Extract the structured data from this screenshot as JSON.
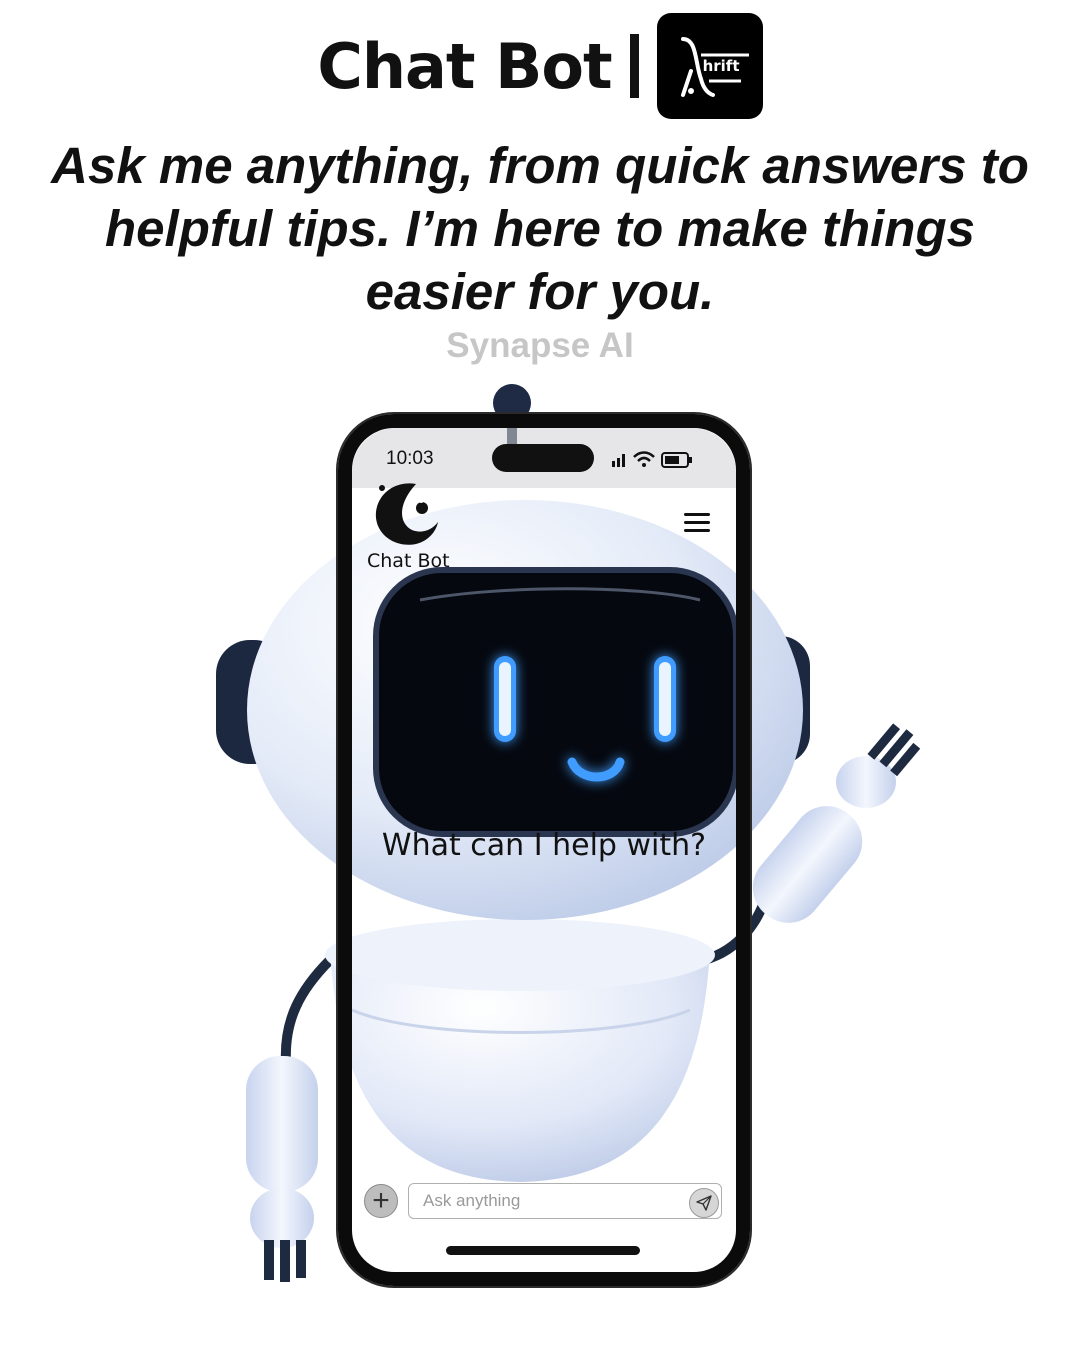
{
  "header": {
    "brand_title": "Chat Bot",
    "logo_text": "hrift"
  },
  "tagline": "Ask me anything, from quick answers to helpful tips. I’m here to make things easier for you.",
  "subtitle": "Synapse AI",
  "phone": {
    "status_bar": {
      "time": "10:03",
      "icons": [
        "signal-icon",
        "wifi-icon",
        "battery-icon"
      ]
    },
    "app": {
      "name": "Chat Bot",
      "menu_icon": "hamburger-menu-icon",
      "prompt": "What can I help with?"
    },
    "composer": {
      "attach_icon": "plus-icon",
      "placeholder": "Ask anything",
      "send_icon": "send-icon"
    }
  },
  "colors": {
    "robot_body": "#dfe8f8",
    "robot_visor": "#070c18",
    "robot_glow": "#3f9dff",
    "subtitle": "#c6c6c6"
  }
}
